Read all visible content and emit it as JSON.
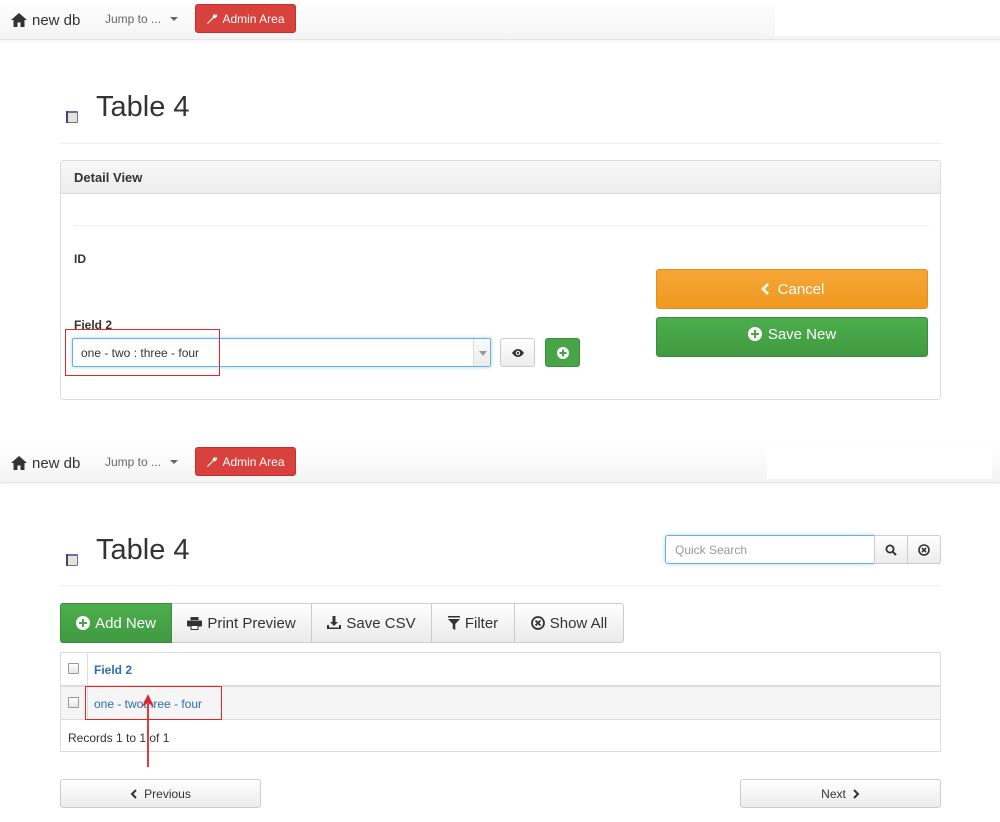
{
  "navbar": {
    "brand_label": "new db",
    "brand_icon": "home-icon",
    "jump_label": "Jump to ...",
    "admin_label": "Admin Area",
    "admin_icon": "wrench-icon"
  },
  "detail_page": {
    "title": "Table 4",
    "panel_heading": "Detail View",
    "id_label": "ID",
    "field2_label": "Field 2",
    "field2_value": "one - two : three - four",
    "cancel_label": "Cancel",
    "save_label": "Save New"
  },
  "list_page": {
    "title": "Table 4",
    "search_placeholder": "Quick Search",
    "toolbar": {
      "add_label": "Add New",
      "print_label": "Print Preview",
      "csv_label": "Save CSV",
      "filter_label": "Filter",
      "show_all_label": "Show All"
    },
    "table": {
      "column_header": "Field 2",
      "rows": [
        {
          "field2": "one - twothree - four"
        }
      ],
      "records_text": "Records 1 to 1 of 1"
    },
    "previous_label": "Previous",
    "next_label": "Next"
  },
  "colors": {
    "danger": "#d9413c",
    "warning": "#f0a030",
    "success": "#47a447",
    "link": "#2a6db5",
    "annotation": "#e0262b"
  }
}
